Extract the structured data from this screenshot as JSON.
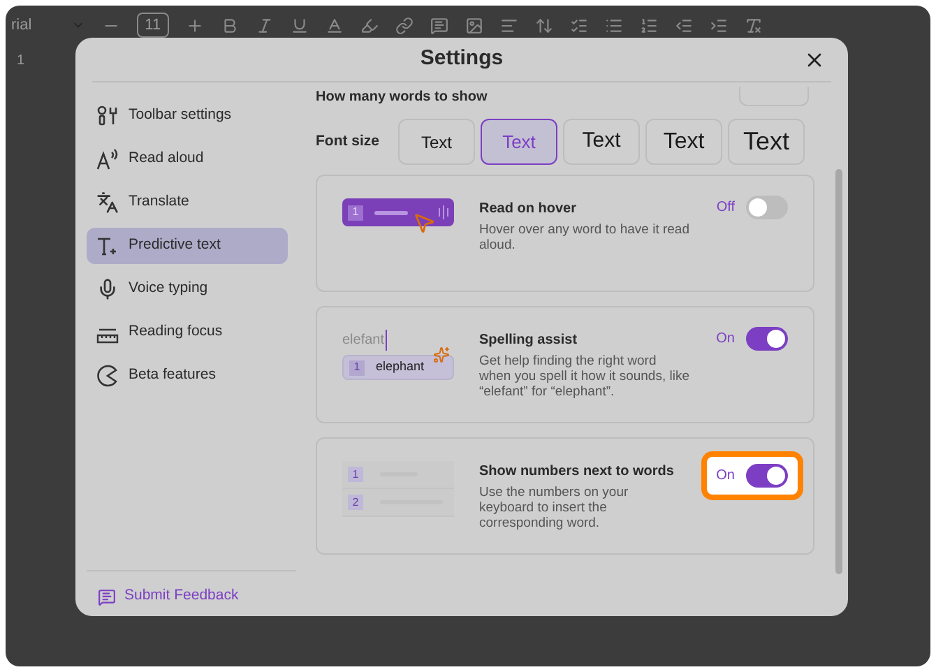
{
  "editor_toolbar": {
    "font": "rial",
    "font_size": "11",
    "ruler_mark": "1"
  },
  "window": {
    "title": "Settings"
  },
  "sidebar": {
    "items": [
      {
        "label": "Toolbar settings",
        "selected": false
      },
      {
        "label": "Read aloud",
        "selected": false
      },
      {
        "label": "Translate",
        "selected": false
      },
      {
        "label": "Predictive text",
        "selected": true
      },
      {
        "label": "Voice typing",
        "selected": false
      },
      {
        "label": "Reading focus",
        "selected": false
      },
      {
        "label": "Beta features",
        "selected": false
      }
    ],
    "feedback": "Submit Feedback"
  },
  "words_setting": {
    "label": "How many words to show"
  },
  "font_size": {
    "label": "Font size",
    "options": [
      {
        "label": "Text",
        "selected": false
      },
      {
        "label": "Text",
        "selected": true
      },
      {
        "label": "Text",
        "selected": false
      },
      {
        "label": "Text",
        "selected": false
      },
      {
        "label": "Text",
        "selected": false
      }
    ]
  },
  "features": [
    {
      "kind": "hover",
      "title": "Read on hover",
      "description": "Hover over any word to have it read aloud.",
      "state_label": "Off",
      "on": false,
      "highlighted": false,
      "preview": [
        "1"
      ]
    },
    {
      "kind": "spelling",
      "title": "Spelling assist",
      "description": "Get help finding the right word when you spell it how it sounds, like “elefant” for “elephant”.",
      "state_label": "On",
      "on": true,
      "highlighted": false,
      "preview": [
        "elefant",
        "1",
        "elephant"
      ]
    },
    {
      "kind": "numbers",
      "title": "Show numbers next to words",
      "description": "Use the numbers on your keyboard to insert the corresponding word.",
      "state_label": "On",
      "on": true,
      "highlighted": true,
      "preview": [
        "1",
        "2"
      ]
    }
  ]
}
